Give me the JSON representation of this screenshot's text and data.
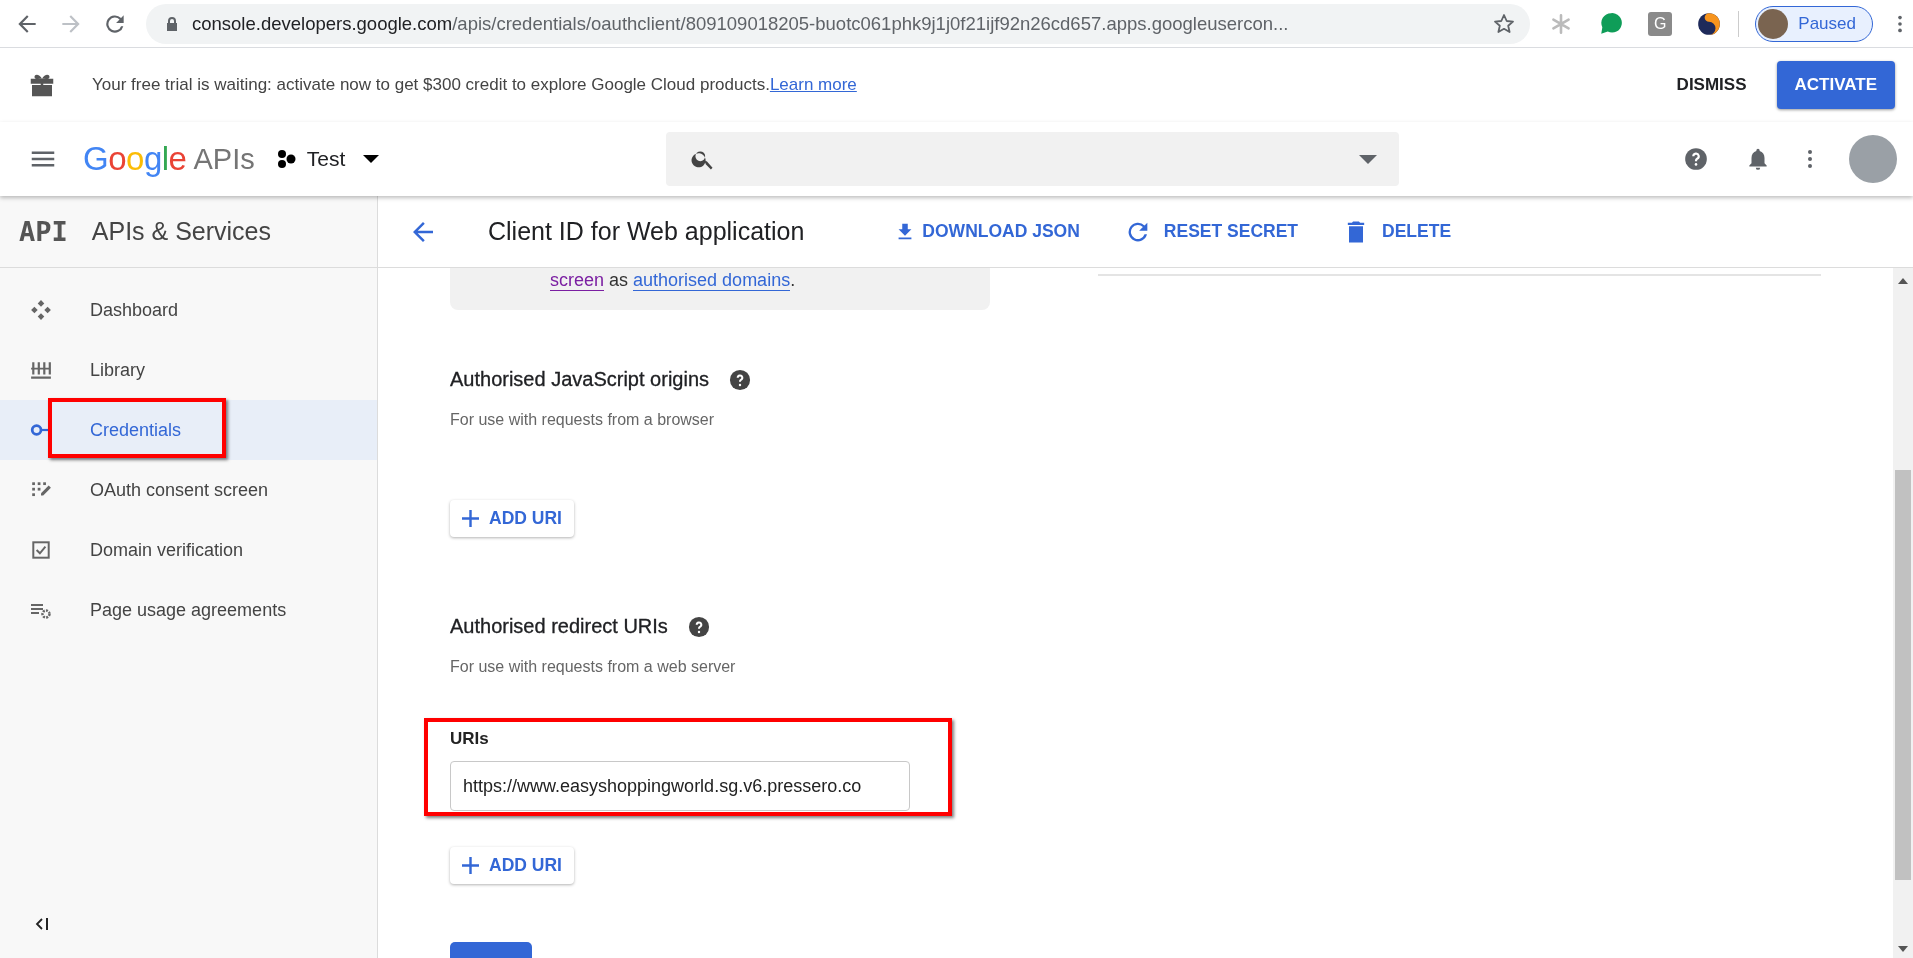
{
  "browser": {
    "url": {
      "host": "console.developers.google.com",
      "path": "/apis/credentials/oauthclient/809109018205-buotc061phk9j1j0f21ijf92n26cd657.apps.googleusercon..."
    },
    "forward_disabled": true,
    "extensions": [
      {
        "kind": "snowflake"
      },
      {
        "kind": "chat"
      },
      {
        "kind": "letter",
        "text": "G"
      },
      {
        "kind": "crescent"
      }
    ],
    "profile": {
      "label": "Paused"
    }
  },
  "banner": {
    "text": "Your free trial is waiting: activate now to get $300 credit to explore Google Cloud products.",
    "link": "Learn more",
    "buttons": [
      {
        "label": "DISMISS",
        "kind": "text"
      },
      {
        "label": "ACTIVATE",
        "kind": "primary"
      }
    ]
  },
  "header": {
    "logo": "Google",
    "product": "APIs",
    "project": "Test"
  },
  "sidebar": {
    "logo": "API",
    "title": "APIs & Services",
    "items": [
      {
        "label": "Dashboard",
        "selected": false
      },
      {
        "label": "Library",
        "selected": false
      },
      {
        "label": "Credentials",
        "selected": true
      },
      {
        "label": "OAuth consent screen",
        "selected": false
      },
      {
        "label": "Domain verification",
        "selected": false
      },
      {
        "label": "Page usage agreements",
        "selected": false
      }
    ]
  },
  "page": {
    "title": "Client ID for Web application",
    "actions": [
      {
        "label": "DOWNLOAD JSON"
      },
      {
        "label": "RESET SECRET"
      },
      {
        "label": "DELETE"
      }
    ],
    "info": [
      {
        "text": "screen",
        "kind": "visited-link"
      },
      {
        "text": " as ",
        "kind": "text"
      },
      {
        "text": "authorised domains",
        "kind": "link"
      },
      {
        "text": ".",
        "kind": "text"
      }
    ],
    "sections": [
      {
        "title": "Authorised JavaScript origins",
        "hint": "For use with requests from a browser",
        "add_button": "ADD URI"
      },
      {
        "title": "Authorised redirect URIs",
        "hint": "For use with requests from a web server",
        "field": {
          "label": "URIs",
          "value": "https://www.easyshoppingworld.sg.v6.pressero.co"
        },
        "add_button": "ADD URI"
      }
    ]
  }
}
